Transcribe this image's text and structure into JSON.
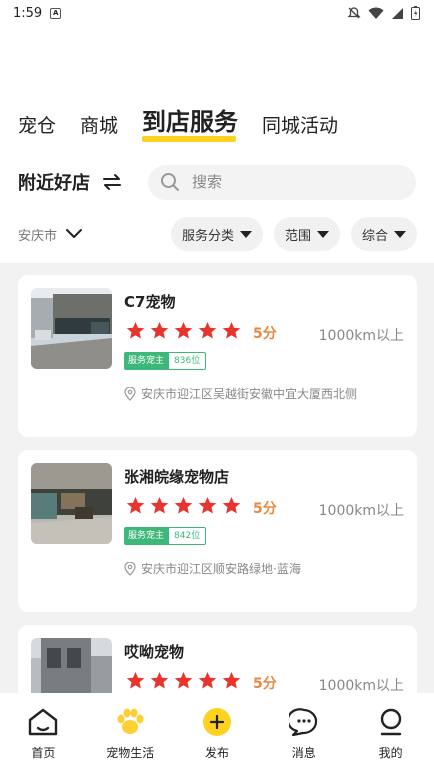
{
  "status_bar": {
    "time": "1:59"
  },
  "tabs": [
    {
      "label": "宠仓"
    },
    {
      "label": "商城"
    },
    {
      "label": "到店服务"
    },
    {
      "label": "同城活动"
    }
  ],
  "nearby": {
    "title": "附近好店"
  },
  "search": {
    "placeholder": "搜索"
  },
  "filters": {
    "city": "安庆市",
    "chips": [
      {
        "label": "服务分类"
      },
      {
        "label": "范围"
      },
      {
        "label": "综合"
      }
    ]
  },
  "stores": [
    {
      "name": "C7宠物",
      "rating_stars": 5,
      "score": "5分",
      "distance": "1000km以上",
      "badge": "服务宠主",
      "rank": "836位",
      "address": "安庆市迎江区吴越街安徽中宜大厦西北侧"
    },
    {
      "name": "张湘皖缘宠物店",
      "rating_stars": 5,
      "score": "5分",
      "distance": "1000km以上",
      "badge": "服务宠主",
      "rank": "842位",
      "address": "安庆市迎江区顺安路绿地·蓝海"
    },
    {
      "name": "哎呦宠物",
      "rating_stars": 5,
      "score": "5分",
      "distance": "1000km以上",
      "badge": "",
      "rank": "",
      "address": ""
    }
  ],
  "bottom_nav": [
    {
      "label": "首页",
      "icon": "home-icon"
    },
    {
      "label": "宠物生活",
      "icon": "paw-icon"
    },
    {
      "label": "发布",
      "icon": "plus-circle-icon"
    },
    {
      "label": "消息",
      "icon": "chat-icon"
    },
    {
      "label": "我的",
      "icon": "user-icon"
    }
  ],
  "colors": {
    "accent": "#ffd21f",
    "star": "#e8342c",
    "score": "#e8893f",
    "badge": "#3db77a"
  }
}
